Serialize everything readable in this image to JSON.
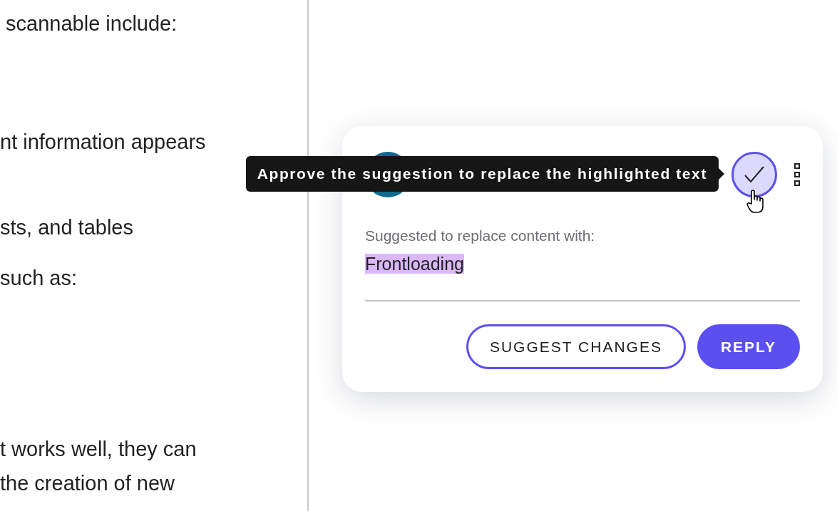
{
  "document": {
    "lines": [
      {
        "text": " scannable include:"
      },
      {
        "text": "nt information appears"
      },
      {
        "text": "sts, and tables"
      },
      {
        "text": "such as:"
      },
      {
        "text": "t works well, they can"
      },
      {
        "text": "the creation of new"
      }
    ]
  },
  "comment": {
    "approve_tooltip": "Approve the suggestion to replace the highlighted text",
    "label": "Suggested to replace content with:",
    "suggestion": "Frontloading",
    "buttons": [
      {
        "label": "SUGGEST CHANGES",
        "kind": "outline"
      },
      {
        "label": "REPLY",
        "kind": "filled"
      }
    ]
  }
}
